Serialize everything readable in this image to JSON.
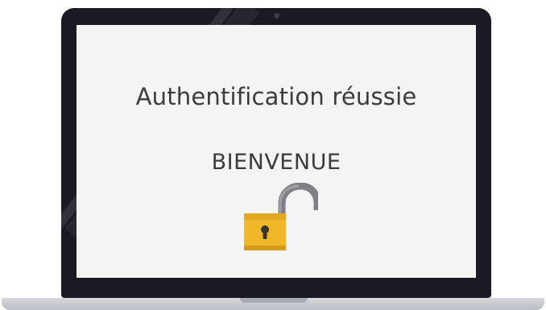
{
  "screen": {
    "title": "Authentification réussie",
    "welcome": "BIENVENUE",
    "icon": "unlocked-padlock-icon"
  },
  "colors": {
    "bezel": "#191a23",
    "screen_background": "#f4f4f4",
    "text": "#3b3b3b",
    "padlock_body": "#f0b72a",
    "padlock_shackle": "#7f8086",
    "laptop_base": "#c8cbd1"
  }
}
